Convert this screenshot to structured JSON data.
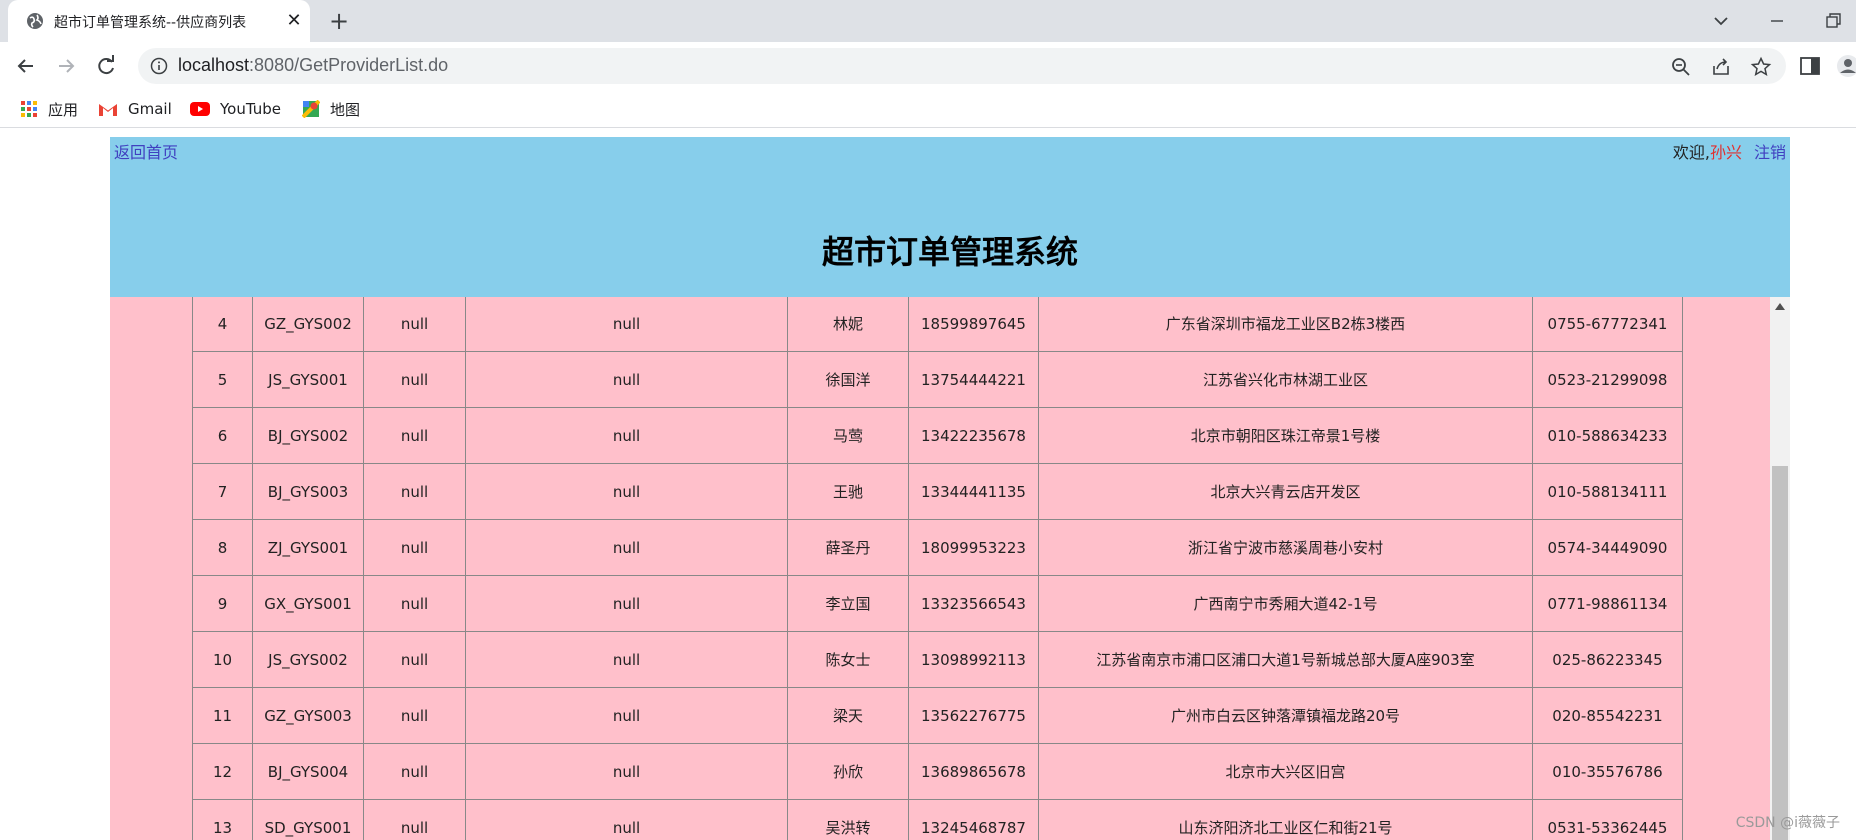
{
  "browser": {
    "tab_title": "超市订单管理系统--供应商列表",
    "url_host": "localhost",
    "url_rest": ":8080/GetProviderList.do"
  },
  "bookmarks": [
    {
      "label": "应用",
      "icon": "apps-grid-icon"
    },
    {
      "label": "Gmail",
      "icon": "gmail-icon"
    },
    {
      "label": "YouTube",
      "icon": "youtube-icon"
    },
    {
      "label": "地图",
      "icon": "maps-icon"
    }
  ],
  "header": {
    "back_link": "返回首页",
    "welcome_prefix": "欢迎,",
    "username": "孙兴",
    "logout": "注销",
    "title": "超市订单管理系统"
  },
  "providers": [
    {
      "id": "4",
      "code": "GZ_GYS002",
      "name": "null",
      "desc": "null",
      "contact": "林妮",
      "phone": "18599897645",
      "address": "广东省深圳市福龙工业区B2栋3楼西",
      "fax": "0755-67772341"
    },
    {
      "id": "5",
      "code": "JS_GYS001",
      "name": "null",
      "desc": "null",
      "contact": "徐国洋",
      "phone": "13754444221",
      "address": "江苏省兴化市林湖工业区",
      "fax": "0523-21299098"
    },
    {
      "id": "6",
      "code": "BJ_GYS002",
      "name": "null",
      "desc": "null",
      "contact": "马莺",
      "phone": "13422235678",
      "address": "北京市朝阳区珠江帝景1号楼",
      "fax": "010-588634233"
    },
    {
      "id": "7",
      "code": "BJ_GYS003",
      "name": "null",
      "desc": "null",
      "contact": "王驰",
      "phone": "13344441135",
      "address": "北京大兴青云店开发区",
      "fax": "010-588134111"
    },
    {
      "id": "8",
      "code": "ZJ_GYS001",
      "name": "null",
      "desc": "null",
      "contact": "薛圣丹",
      "phone": "18099953223",
      "address": "浙江省宁波市慈溪周巷小安村",
      "fax": "0574-34449090"
    },
    {
      "id": "9",
      "code": "GX_GYS001",
      "name": "null",
      "desc": "null",
      "contact": "李立国",
      "phone": "13323566543",
      "address": "广西南宁市秀厢大道42-1号",
      "fax": "0771-98861134"
    },
    {
      "id": "10",
      "code": "JS_GYS002",
      "name": "null",
      "desc": "null",
      "contact": "陈女士",
      "phone": "13098992113",
      "address": "江苏省南京市浦口区浦口大道1号新城总部大厦A座903室",
      "fax": "025-86223345"
    },
    {
      "id": "11",
      "code": "GZ_GYS003",
      "name": "null",
      "desc": "null",
      "contact": "梁天",
      "phone": "13562276775",
      "address": "广州市白云区钟落潭镇福龙路20号",
      "fax": "020-85542231"
    },
    {
      "id": "12",
      "code": "BJ_GYS004",
      "name": "null",
      "desc": "null",
      "contact": "孙欣",
      "phone": "13689865678",
      "address": "北京市大兴区旧宫",
      "fax": "010-35576786"
    },
    {
      "id": "13",
      "code": "SD_GYS001",
      "name": "null",
      "desc": "null",
      "contact": "吴洪转",
      "phone": "13245468787",
      "address": "山东济阳济北工业区仁和街21号",
      "fax": "0531-53362445"
    }
  ],
  "watermark": "CSDN @i薇薇子",
  "colors": {
    "header_bg": "#87ceeb",
    "content_bg": "#ffc0cb",
    "link": "#4040c0",
    "username": "#e03030"
  }
}
